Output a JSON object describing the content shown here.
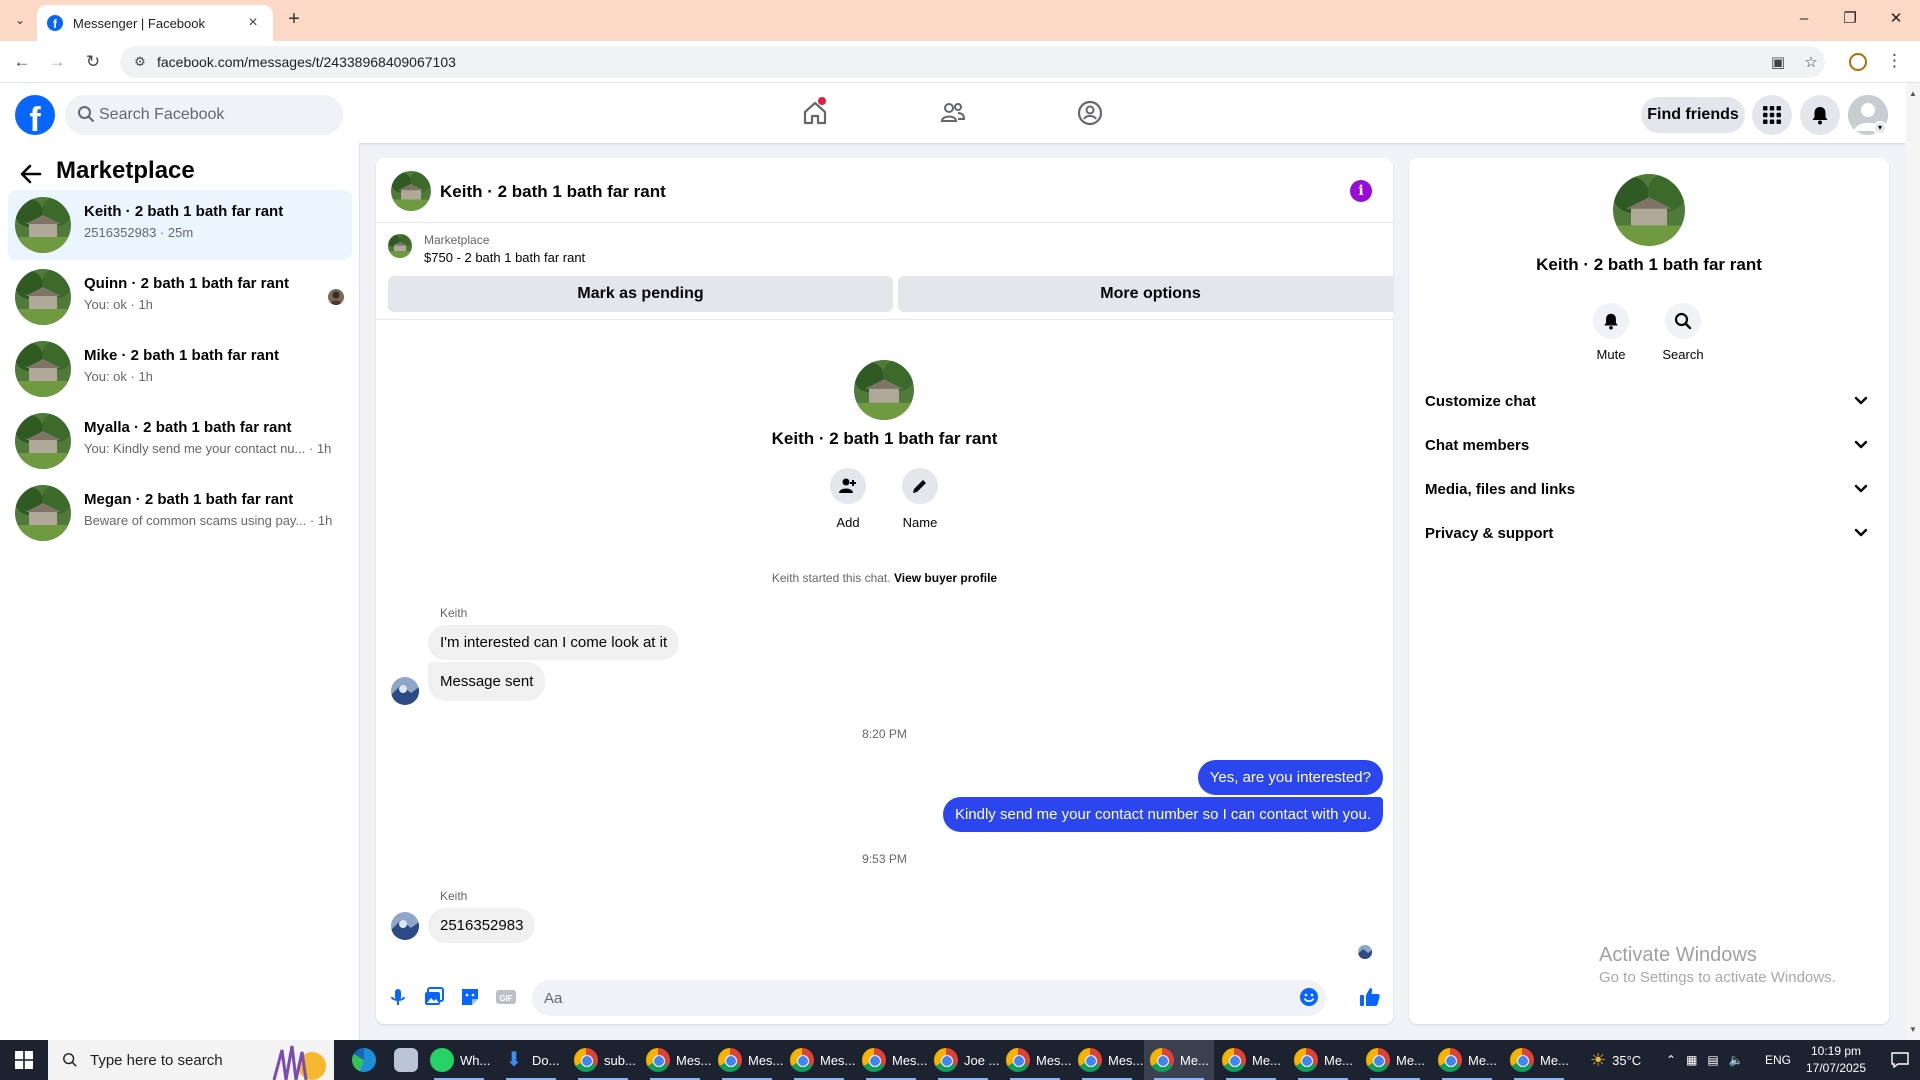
{
  "browser": {
    "tab_title": "Messenger | Facebook",
    "url": "facebook.com/messages/t/24338968409067103"
  },
  "fb_header": {
    "search_placeholder": "Search Facebook",
    "find_friends_label": "Find friends",
    "brand_color": "#0866ff"
  },
  "sidebar": {
    "title": "Marketplace",
    "conversations": [
      {
        "name": "Keith · 2 bath 1 bath far rant",
        "preview": "2516352983 · 25m",
        "active": true
      },
      {
        "name": "Quinn · 2 bath 1 bath far rant",
        "preview": "You: ok · 1h",
        "active": false
      },
      {
        "name": "Mike · 2 bath 1 bath far rant",
        "preview": "You: ok · 1h",
        "active": false
      },
      {
        "name": "Myalla · 2 bath 1 bath far rant",
        "preview": "You: Kindly send me your contact nu... · 1h",
        "active": false
      },
      {
        "name": "Megan · 2 bath 1 bath far rant",
        "preview": "Beware of common scams using pay... · 1h",
        "active": false
      }
    ]
  },
  "chat": {
    "title": "Keith · 2 bath 1 bath far rant",
    "listing": {
      "source": "Marketplace",
      "price_title": "$750 - 2 bath 1 bath far rant",
      "mark_pending_label": "Mark as pending",
      "more_options_label": "More options"
    },
    "intro": {
      "name": "Keith · 2 bath 1 bath far rant",
      "add_label": "Add",
      "name_label": "Name",
      "started_text": "Keith started this chat.",
      "buyer_profile_link": "View buyer profile"
    },
    "messages": {
      "sender_1": "Keith",
      "in_1": "I'm interested can I come look at it",
      "in_2": "Message sent",
      "time_1": "8:20 PM",
      "out_1": "Yes, are you interested?",
      "out_2": "Kindly send me your contact number so I can contact with you.",
      "time_2": "9:53 PM",
      "sender_2": "Keith",
      "in_3": "2516352983"
    },
    "composer_placeholder": "Aa",
    "outgoing_bubble_color": "#2b46ee"
  },
  "details": {
    "name": "Keith · 2 bath 1 bath far rant",
    "mute_label": "Mute",
    "search_label": "Search",
    "sections": [
      "Customize chat",
      "Chat members",
      "Media, files and links",
      "Privacy & support"
    ]
  },
  "watermark": {
    "line1": "Activate Windows",
    "line2": "Go to Settings to activate Windows."
  },
  "taskbar": {
    "search_placeholder": "Type here to search",
    "apps": [
      "Wh...",
      "Do...",
      "sub...",
      "Mes...",
      "Mes...",
      "Mes...",
      "Mes...",
      "Joe ...",
      "Mes...",
      "Mes...",
      "Me...",
      "Me...",
      "Me...",
      "Me...",
      "Me...",
      "Me..."
    ],
    "weather": "35°C",
    "language": "ENG",
    "time": "10:19 pm",
    "date": "17/07/2025"
  }
}
